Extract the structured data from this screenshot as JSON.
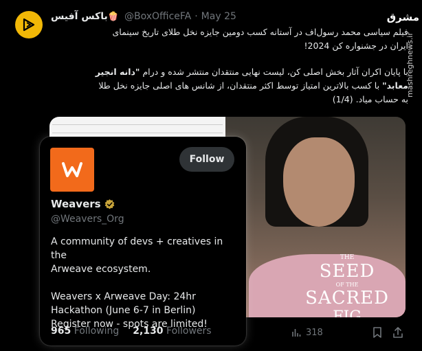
{
  "tweet": {
    "author_name": "باکس آفیس",
    "author_emoji": "🍿",
    "handle": "@BoxOfficeFA",
    "separator": "·",
    "date": "May 25",
    "line1": "فیلم سیاسی محمد رسول‌اف در آستانه کسب دومین جایزه نخل طلای تاریخ سینمای",
    "line2": "ایران در جشنواره کن 2024!",
    "line3": "با پایان اکران آثار بخش اصلی کن، لیست نهایی منتقدان منتشر شده و درام",
    "line3_bold": "\"دانه انجیر",
    "line4_bold": "معابد\"",
    "line4": "با کسب بالاترین امتیاز توسط اکثر منتقدان، از شانس های اصلی جایزه نخل طلا",
    "line5": "به حساب میاد. (1/4)",
    "views": "318"
  },
  "watermark": {
    "logo": "مشرق",
    "site": "mashreghnews.ir"
  },
  "poster": {
    "the": "THE",
    "seed": "SEED",
    "of": "OF THE",
    "sacred": "SACRED",
    "fig": "FIG"
  },
  "hover_card": {
    "name": "Weavers",
    "handle": "@Weavers_Org",
    "follow_label": "Follow",
    "bio_line1": "A community of devs + creatives in the",
    "bio_line2": "Arweave ecosystem.",
    "bio_line3": "Weavers x Arweave Day: 24hr",
    "bio_line4": "Hackathon (June 6-7 in Berlin)",
    "bio_line5": "Register now - spots are limited!",
    "following_count": "965",
    "following_label": "Following",
    "followers_count": "2,130",
    "followers_label": "Followers",
    "brand_color": "#f26a1b"
  },
  "colors": {
    "background": "#000000",
    "text": "#e7e9ea",
    "muted": "#71767b",
    "avatar_bg": "#f2b807"
  },
  "icons": [
    "play-triangle-logo",
    "views-bar-icon",
    "bookmark-icon",
    "share-icon",
    "verified-badge-icon"
  ]
}
